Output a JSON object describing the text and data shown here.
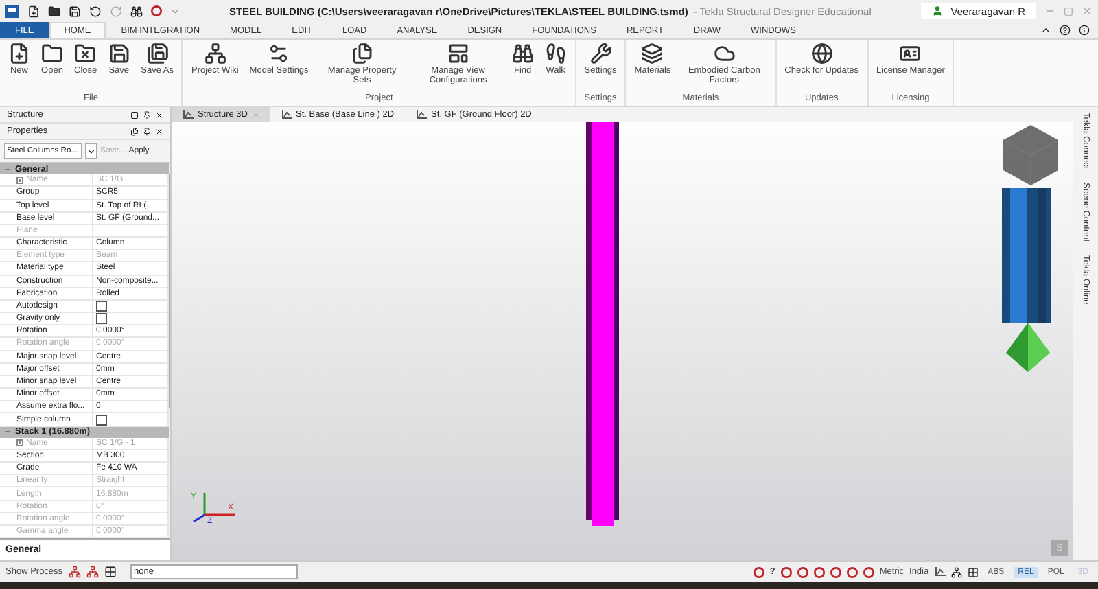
{
  "window": {
    "title": "STEEL BUILDING (C:\\Users\\veeraragavan r\\OneDrive\\Pictures\\TEKLA\\STEEL BUILDING.tsmd)",
    "app": "- Tekla Structural Designer Educational",
    "user": "Veeraragavan R"
  },
  "ribbon_tabs": [
    {
      "label": "FILE",
      "kind": "file",
      "selected": false
    },
    {
      "label": "HOME",
      "kind": "tab",
      "selected": true
    },
    {
      "label": "BIM INTEGRATION",
      "kind": "tab",
      "selected": false
    },
    {
      "label": "MODEL",
      "kind": "tab",
      "selected": false
    },
    {
      "label": "EDIT",
      "kind": "tab",
      "selected": false
    },
    {
      "label": "LOAD",
      "kind": "tab",
      "selected": false
    },
    {
      "label": "ANALYSE",
      "kind": "tab",
      "selected": false
    },
    {
      "label": "DESIGN",
      "kind": "tab",
      "selected": false
    },
    {
      "label": "FOUNDATIONS",
      "kind": "tab",
      "selected": false
    },
    {
      "label": "REPORT",
      "kind": "tab",
      "selected": false
    },
    {
      "label": "DRAW",
      "kind": "tab",
      "selected": false
    },
    {
      "label": "WINDOWS",
      "kind": "tab",
      "selected": false
    }
  ],
  "ribbon_groups": [
    {
      "label": "File",
      "buttons": [
        {
          "label": "New"
        },
        {
          "label": "Open"
        },
        {
          "label": "Close"
        },
        {
          "label": "Save"
        },
        {
          "label": "Save As"
        }
      ]
    },
    {
      "label": "Project",
      "buttons": [
        {
          "label": "Project Wiki"
        },
        {
          "label": "Model Settings"
        },
        {
          "label": "Manage Property Sets"
        },
        {
          "label": "Manage View Configurations"
        },
        {
          "label": "Find"
        },
        {
          "label": "Walk"
        }
      ]
    },
    {
      "label": "Settings",
      "buttons": [
        {
          "label": "Settings"
        }
      ]
    },
    {
      "label": "Materials",
      "buttons": [
        {
          "label": "Materials"
        },
        {
          "label": "Embodied Carbon Factors"
        }
      ]
    },
    {
      "label": "Updates",
      "buttons": [
        {
          "label": "Check for Updates"
        }
      ]
    },
    {
      "label": "Licensing",
      "buttons": [
        {
          "label": "License Manager"
        }
      ]
    }
  ],
  "structure_panel": {
    "title": "Structure"
  },
  "properties_panel": {
    "title": "Properties",
    "set": "Steel Columns Ro...",
    "save": "Save...",
    "apply": "Apply...",
    "footer": "General",
    "sections": [
      {
        "title": "General",
        "rows": [
          {
            "name": "Name",
            "value": "SC 1/G",
            "kind": "expand",
            "disabled": true
          },
          {
            "name": "Group",
            "value": "SCR5",
            "kind": "text",
            "disabled": false
          },
          {
            "name": "Top level",
            "value": "St. Top of RI (...",
            "kind": "text",
            "disabled": false
          },
          {
            "name": "Base level",
            "value": "St. GF (Ground...",
            "kind": "text",
            "disabled": false
          },
          {
            "name": "Plane",
            "value": "",
            "kind": "text",
            "disabled": true
          },
          {
            "name": "Characteristic",
            "value": "Column",
            "kind": "text",
            "disabled": false
          },
          {
            "name": "Element type",
            "value": "Beam",
            "kind": "text",
            "disabled": true
          },
          {
            "name": "Material type",
            "value": "Steel",
            "kind": "text",
            "disabled": false
          },
          {
            "name": "Construction",
            "value": "Non-composite...",
            "kind": "text",
            "disabled": false
          },
          {
            "name": "Fabrication",
            "value": "Rolled",
            "kind": "text",
            "disabled": false
          },
          {
            "name": "Autodesign",
            "checked": false,
            "kind": "checkbox",
            "disabled": false
          },
          {
            "name": "Gravity only",
            "checked": false,
            "kind": "checkbox",
            "disabled": false
          },
          {
            "name": "Rotation",
            "value": "0.0000°",
            "kind": "text",
            "disabled": false
          },
          {
            "name": "Rotation angle",
            "value": "0.0000°",
            "kind": "text",
            "disabled": true
          },
          {
            "name": "Major snap level",
            "value": "Centre",
            "kind": "text",
            "disabled": false
          },
          {
            "name": "Major offset",
            "value": "0mm",
            "kind": "text",
            "disabled": false
          },
          {
            "name": "Minor snap level",
            "value": "Centre",
            "kind": "text",
            "disabled": false
          },
          {
            "name": "Minor offset",
            "value": "0mm",
            "kind": "text",
            "disabled": false
          },
          {
            "name": "Assume extra flo...",
            "value": "0",
            "kind": "text",
            "disabled": false
          },
          {
            "name": "Simple column",
            "checked": false,
            "kind": "checkbox",
            "disabled": false
          }
        ]
      },
      {
        "title": "Stack 1 (16.880m)",
        "rows": [
          {
            "name": "Name",
            "value": "SC 1/G - 1",
            "kind": "expand",
            "disabled": true
          },
          {
            "name": "Section",
            "value": "MB 300",
            "kind": "text",
            "disabled": false
          },
          {
            "name": "Grade",
            "value": "Fe 410 WA",
            "kind": "text",
            "disabled": false
          },
          {
            "name": "Linearity",
            "value": "Straight",
            "kind": "text",
            "disabled": true
          },
          {
            "name": "Length",
            "value": "16.880m",
            "kind": "text",
            "disabled": true
          },
          {
            "name": "Rotation",
            "value": "0°",
            "kind": "text",
            "disabled": true
          },
          {
            "name": "Rotation angle",
            "value": "0.0000°",
            "kind": "text",
            "disabled": true
          },
          {
            "name": "Gamma angle",
            "value": "0.0000°",
            "kind": "text",
            "disabled": true
          }
        ]
      }
    ]
  },
  "view_tabs": [
    {
      "label": "Structure 3D",
      "selected": true
    },
    {
      "label": "St. Base (Base Line ) 2D",
      "selected": false
    },
    {
      "label": "St. GF (Ground Floor) 2D",
      "selected": false
    }
  ],
  "axes": {
    "x": "X",
    "y": "Y",
    "z": "Z"
  },
  "snap_badge": "S",
  "side_tabs": [
    "Tekla Connect",
    "Scene Content",
    "Tekla Online"
  ],
  "status_bar": {
    "show_process": "Show Process",
    "filter": "none",
    "help": "?",
    "units": "Metric",
    "code": "India",
    "modes": [
      {
        "label": "ABS",
        "selected": false,
        "disabled": false
      },
      {
        "label": "REL",
        "selected": true,
        "disabled": false
      },
      {
        "label": "POL",
        "selected": false,
        "disabled": false
      },
      {
        "label": "3D",
        "selected": false,
        "disabled": true
      }
    ]
  }
}
